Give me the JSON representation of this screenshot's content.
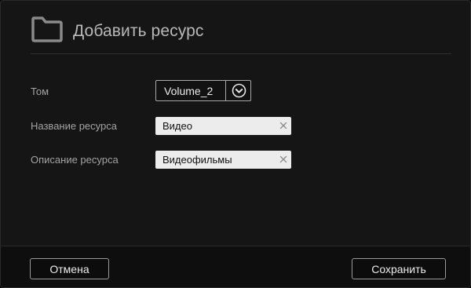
{
  "dialog": {
    "title": "Добавить ресурс",
    "header_icon": "folder-icon"
  },
  "form": {
    "volume": {
      "label": "Том",
      "selected": "Volume_2",
      "dropdown_icon": "chevron-down-circle-icon"
    },
    "share_name": {
      "label": "Название ресурса",
      "value": "Видео",
      "clear_icon": "clear-icon"
    },
    "share_description": {
      "label": "Описание ресурса",
      "value": "Видеофильмы",
      "clear_icon": "clear-icon"
    }
  },
  "footer": {
    "cancel_label": "Отмена",
    "save_label": "Сохранить"
  },
  "colors": {
    "background": "#151515",
    "text_label": "#a3a3a3",
    "title": "#b8b8b8",
    "field_bg": "#ececec",
    "button_border": "#9a9a9a"
  }
}
